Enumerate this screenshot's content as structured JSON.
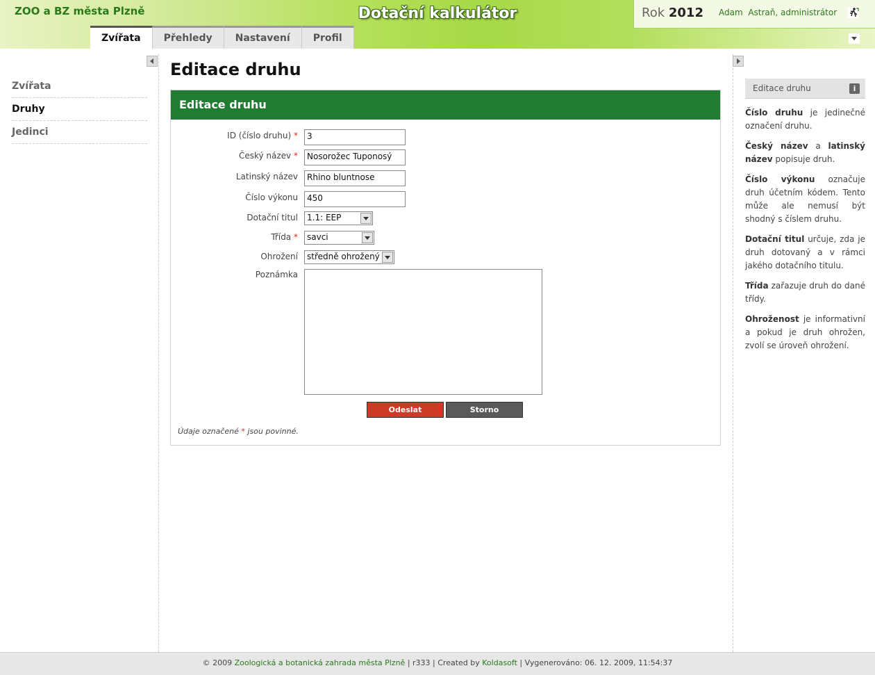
{
  "header": {
    "org_name": "ZOO a BZ města Plzně",
    "app_title": "Dotační kalkulátor",
    "year_label": "Rok",
    "year_value": "2012",
    "user_first": "Adam",
    "user_last": "Astraň",
    "user_role": ", administrátor",
    "logout_icon": "logout-running-man-icon",
    "menu_icon": "chevron-down-icon"
  },
  "tabs": [
    {
      "label": "Zvířata",
      "active": true
    },
    {
      "label": "Přehledy",
      "active": false
    },
    {
      "label": "Nastavení",
      "active": false
    },
    {
      "label": "Profil",
      "active": false
    }
  ],
  "sidebar": {
    "items": [
      {
        "label": "Zvířata",
        "active": false
      },
      {
        "label": "Druhy",
        "active": true
      },
      {
        "label": "Jedinci",
        "active": false
      }
    ]
  },
  "main": {
    "page_title": "Editace druhu",
    "panel_title": "Editace druhu",
    "form": {
      "id_label": "ID (číslo druhu)",
      "id_value": "3",
      "czech_label": "Český název",
      "czech_value": "Nosorožec Tuponosý",
      "latin_label": "Latinský název",
      "latin_value": "Rhino bluntnose",
      "output_label": "Číslo výkonu",
      "output_value": "450",
      "subsidy_label": "Dotační titul",
      "subsidy_value": "1.1: EEP",
      "class_label": "Třída",
      "class_value": "savci",
      "threat_label": "Ohrožení",
      "threat_value": "středně ohrožený",
      "note_label": "Poznámka",
      "note_value": "",
      "required_mark": "*",
      "submit_label": "Odeslat",
      "cancel_label": "Storno",
      "required_note_pre": "Údaje označené ",
      "required_note_post": " jsou povinné."
    }
  },
  "help": {
    "title": "Editace druhu",
    "info_icon": "i",
    "paragraphs": [
      {
        "bold": "Číslo druhu",
        "text": " je jedinečné označení druhu."
      },
      {
        "bold": "Český název",
        "mid": " a ",
        "bold2": "latinský název",
        "text": " popisuje druh."
      },
      {
        "bold": "Číslo výkonu",
        "text": " označuje druh účetním kódem. Tento může ale nemusí být shodný s číslem druhu."
      },
      {
        "bold": "Dotační titul",
        "text": " určuje, zda je druh dotovaný a v rámci jakého dotačního titulu."
      },
      {
        "bold": "Třída",
        "text": " zařazuje druh do dané třídy."
      },
      {
        "bold": "Ohroženost",
        "text": " je informativní a pokud je druh ohrožen, zvolí se úroveň ohrožení."
      }
    ]
  },
  "footer": {
    "copy": "© 2009 ",
    "org_link": "Zoologická a botanická zahrada města Plzně",
    "rev": " | r333 | Created by ",
    "author_link": "Koldasoft",
    "generated": " | Vygenerováno: 06. 12. 2009, 11:54:37"
  }
}
